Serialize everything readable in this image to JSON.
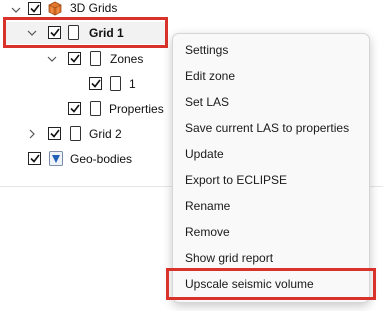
{
  "tree": {
    "nodes": [
      {
        "label": "3D Grids",
        "checked": true,
        "icon": "cube-grid-icon"
      },
      {
        "label": "Grid 1",
        "checked": true,
        "icon": "document-icon",
        "selected": true,
        "expanded": true
      },
      {
        "label": "Zones",
        "checked": true,
        "icon": "document-icon",
        "expanded": true
      },
      {
        "label": "1",
        "checked": true,
        "icon": "document-icon"
      },
      {
        "label": "Properties",
        "checked": true,
        "icon": "document-icon"
      },
      {
        "label": "Grid 2",
        "checked": true,
        "icon": "document-icon",
        "expanded": false
      },
      {
        "label": "Geo-bodies",
        "checked": true,
        "icon": "geobody-shield-icon"
      }
    ]
  },
  "context_menu": {
    "items": [
      "Settings",
      "Edit zone",
      "Set LAS",
      "Save current LAS to properties",
      "Update",
      "Export to ECLIPSE",
      "Rename",
      "Remove",
      "Show grid report",
      "Upscale seismic volume"
    ],
    "highlighted_item": "Upscale seismic volume"
  },
  "colors": {
    "highlight_border": "#d9322b",
    "selection_accent": "#1e7fd9",
    "cube_orange": "#e3762b",
    "geobody_blue": "#1f5fb5"
  }
}
